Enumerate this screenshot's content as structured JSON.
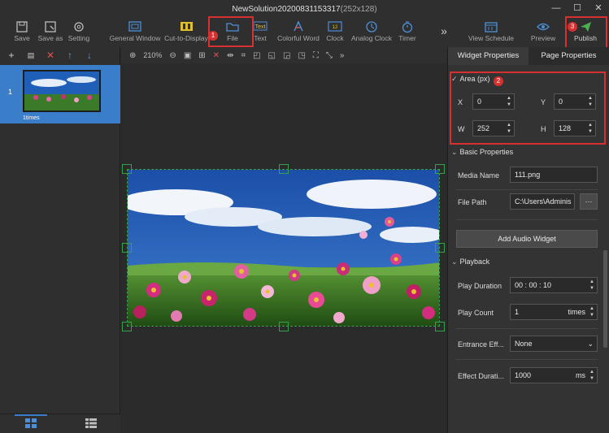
{
  "window": {
    "title_main": "NewSolution20200831153317",
    "title_dims": "(252x128)",
    "controls": [
      "minimize",
      "maximize",
      "close"
    ]
  },
  "toolbar": {
    "items": [
      {
        "label": "Save",
        "icon": "save-icon"
      },
      {
        "label": "Save as",
        "icon": "save-as-icon"
      },
      {
        "label": "Setting",
        "icon": "gear-icon"
      },
      {
        "label": "General Window",
        "icon": "window-icon"
      },
      {
        "label": "Cut-to-Display",
        "icon": "film-icon"
      },
      {
        "label": "File",
        "icon": "folder-icon"
      },
      {
        "label": "Text",
        "icon": "text-icon"
      },
      {
        "label": "Colorful Word",
        "icon": "colorful-word-icon"
      },
      {
        "label": "Clock",
        "icon": "clock-icon"
      },
      {
        "label": "Analog Clock",
        "icon": "analog-clock-icon"
      },
      {
        "label": "Timer",
        "icon": "timer-icon"
      },
      {
        "label": "View Schedule",
        "icon": "calendar-icon"
      },
      {
        "label": "Preview",
        "icon": "eye-icon"
      },
      {
        "label": "Publish",
        "icon": "send-icon"
      }
    ],
    "more": "»"
  },
  "annotations": {
    "badge1": "1",
    "badge2": "2",
    "badge3": "3",
    "highlight_color": "#d73030"
  },
  "left": {
    "page_number": "1",
    "page_caption": "1times"
  },
  "canvas": {
    "zoom": "210%",
    "handle_color": "#36a04b"
  },
  "right": {
    "tabs": [
      "Widget Properties",
      "Page Properties"
    ],
    "area": {
      "title": "Area (px)",
      "x_label": "X",
      "x": "0",
      "y_label": "Y",
      "y": "0",
      "w_label": "W",
      "w": "252",
      "h_label": "H",
      "h": "128"
    },
    "basic": {
      "title": "Basic Properties",
      "media_name_label": "Media Name",
      "media_name": "111.png",
      "file_path_label": "File Path",
      "file_path": "C:\\Users\\Adminis",
      "browse": "···",
      "add_audio": "Add Audio Widget"
    },
    "playback": {
      "title": "Playback",
      "duration_label": "Play Duration",
      "duration": "00 : 00 : 10",
      "count_label": "Play Count",
      "count": "1",
      "count_unit": "times",
      "entrance_label": "Entrance Eff...",
      "entrance": "None",
      "effect_dur_label": "Effect Durati...",
      "effect_dur": "1000",
      "effect_dur_unit": "ms"
    }
  },
  "colors": {
    "accent": "#3a7ec9",
    "publish": "#4caf50"
  }
}
